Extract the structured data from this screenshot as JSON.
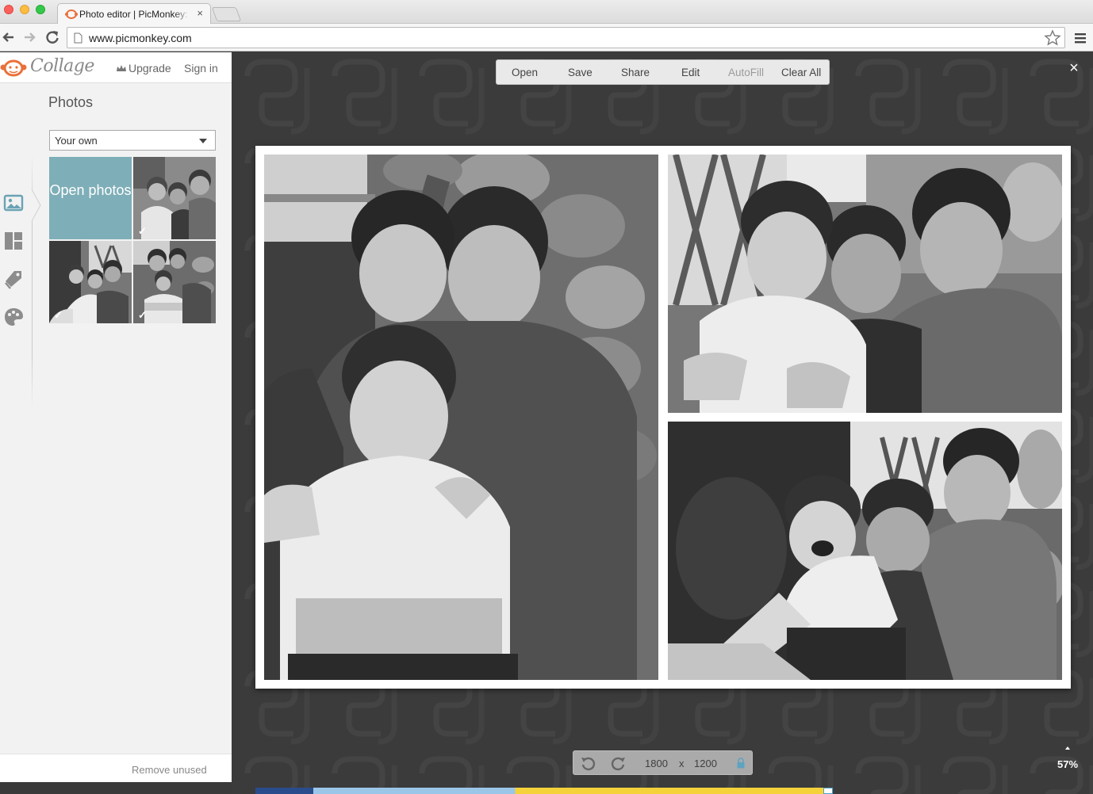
{
  "browser": {
    "tab_title": "Photo editor | PicMonkey: Photo Editing Made of Awesome",
    "tab_close": "×",
    "url": "www.picmonkey.com"
  },
  "panel": {
    "logo_text": "Collage",
    "upgrade_label": "Upgrade",
    "signin_label": "Sign in",
    "section_title": "Photos",
    "source_select_value": "Your own",
    "open_photos_label": "Open photos",
    "thumbnails": [
      {
        "name": "three-boys-smiling",
        "used": true
      },
      {
        "name": "boys-laughing",
        "used": true
      },
      {
        "name": "boys-sitting-on-rocks",
        "used": true
      }
    ],
    "check_mark": "✓",
    "remove_unused_label": "Remove unused",
    "rail_icons": [
      "photos-icon",
      "layouts-icon",
      "embellishments-icon",
      "background-palette-icon"
    ]
  },
  "menu": {
    "items": [
      {
        "label": "Open",
        "enabled": true
      },
      {
        "label": "Save",
        "enabled": true
      },
      {
        "label": "Share",
        "enabled": true
      },
      {
        "label": "Edit",
        "enabled": true
      },
      {
        "label": "AutoFill",
        "enabled": false
      },
      {
        "label": "Clear All",
        "enabled": true
      }
    ],
    "close_label": "×"
  },
  "canvas": {
    "photos": [
      {
        "name": "three-boys-on-rocks",
        "description_icon": "photo"
      },
      {
        "name": "three-boys-smiling",
        "description_icon": "photo"
      },
      {
        "name": "boys-laughing-on-steps",
        "description_icon": "photo"
      }
    ]
  },
  "sizebar": {
    "width": "1800",
    "times": "x",
    "height": "1200"
  },
  "zoom": "57%",
  "colors": {
    "workspace_bg": "#3b3b3b",
    "open_photos_tile": "#7eaeb8",
    "panel_bg": "#f2f2f2",
    "logo_orange": "#e9703a"
  }
}
